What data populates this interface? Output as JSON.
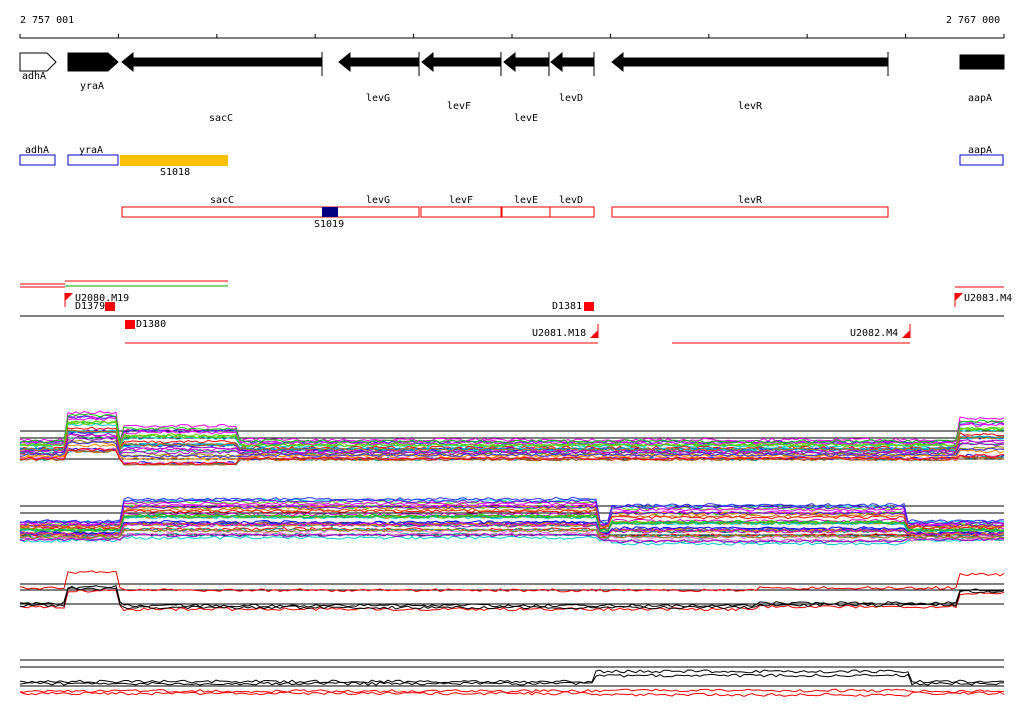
{
  "ruler": {
    "start_label": "2 757 001",
    "end_label": "2 767 000"
  },
  "genes": [
    {
      "label": "adhA",
      "strand": "+",
      "style": "outline"
    },
    {
      "label": "yraA",
      "strand": "+",
      "style": "filled"
    },
    {
      "label": "sacC",
      "strand": "-",
      "style": "filled"
    },
    {
      "label": "levG",
      "strand": "-",
      "style": "filled"
    },
    {
      "label": "levF",
      "strand": "-",
      "style": "filled"
    },
    {
      "label": "levE",
      "strand": "-",
      "style": "filled"
    },
    {
      "label": "levD",
      "strand": "-",
      "style": "filled"
    },
    {
      "label": "levR",
      "strand": "-",
      "style": "filled"
    },
    {
      "label": "aapA",
      "strand": "+",
      "style": "filled"
    }
  ],
  "blue_boxes": [
    "adhA",
    "yraA",
    "aapA"
  ],
  "red_boxes": [
    "sacC",
    "levG",
    "levF",
    "levE",
    "levD",
    "levR"
  ],
  "segments": {
    "yellow": "S1018",
    "navy": "S1019"
  },
  "markers": [
    "U2080.M19",
    "D1379",
    "D1380",
    "D1381",
    "U2081.M18",
    "U2082.M4",
    "U2083.M4"
  ],
  "colors": {
    "gene_fill": "#000000",
    "blue_box": "#0000cc",
    "red_box": "#ee0000",
    "yellow_segment": "#ffc000",
    "navy_segment": "#000080",
    "marker": "#ff0000",
    "green_line": "#00aa00"
  }
}
